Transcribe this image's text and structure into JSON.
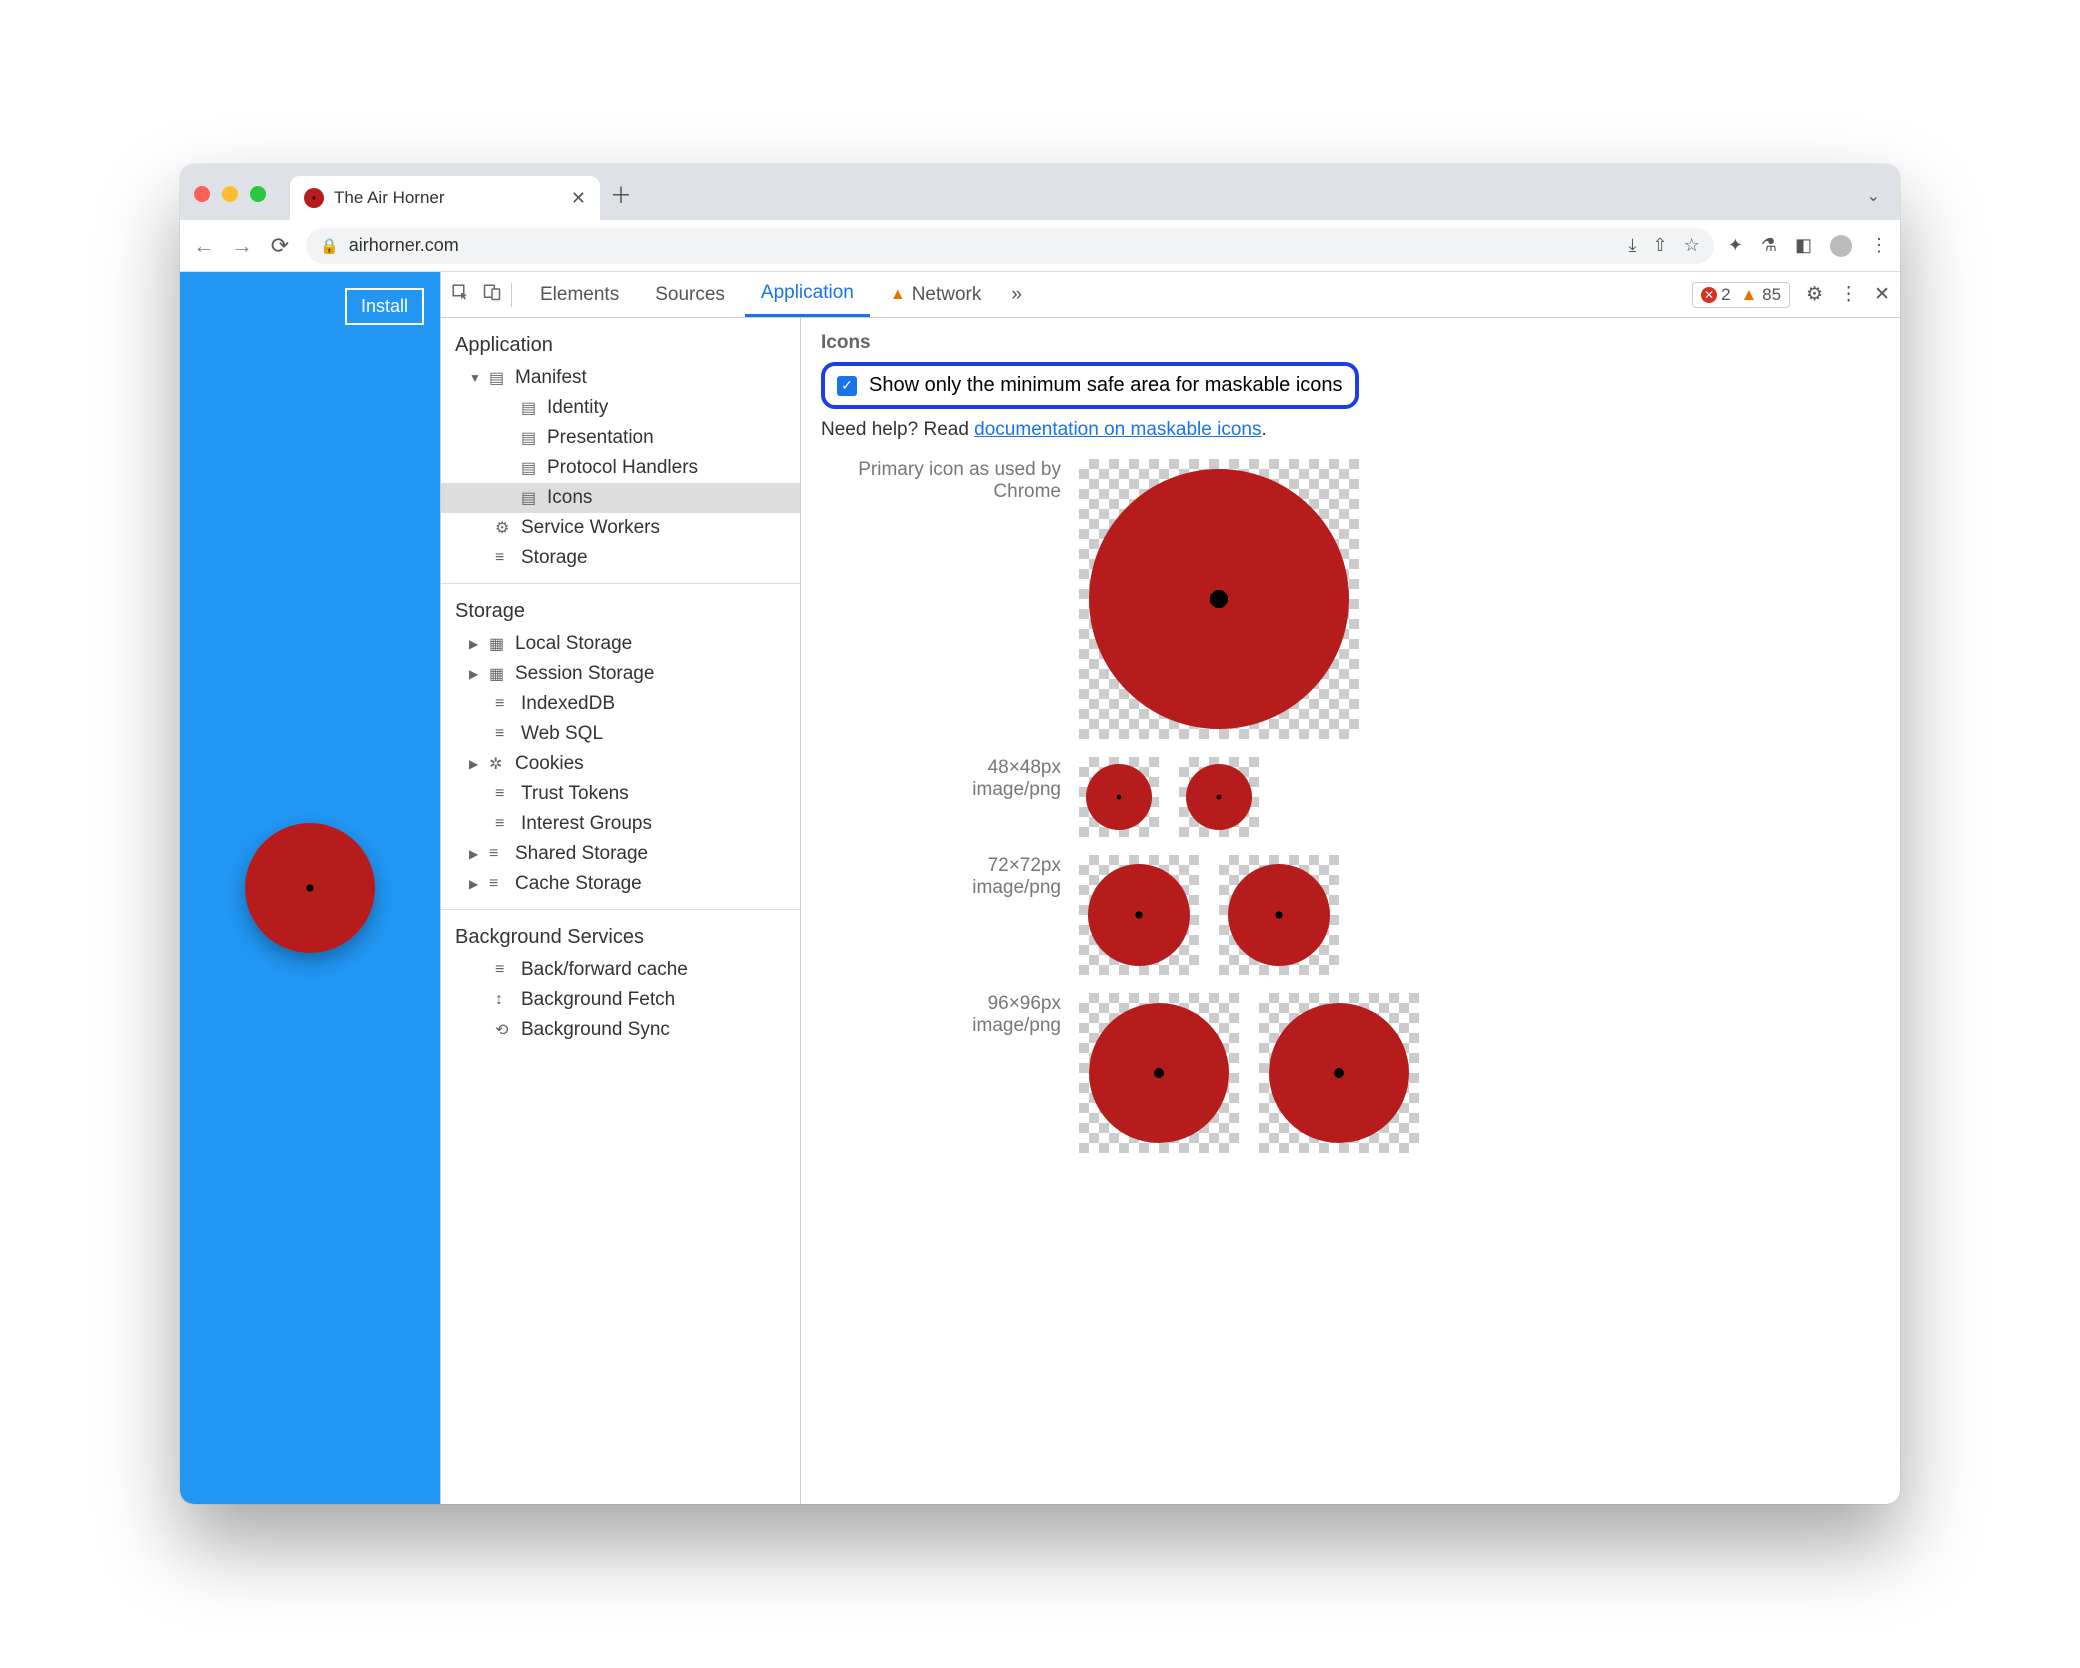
{
  "browser": {
    "tab_title": "The Air Horner",
    "url": "airhorner.com"
  },
  "page": {
    "install_label": "Install"
  },
  "devtools": {
    "tabs": {
      "elements": "Elements",
      "sources": "Sources",
      "application": "Application",
      "network": "Network"
    },
    "errors": "2",
    "warnings": "85",
    "sidebar": {
      "application": "Application",
      "manifest": "Manifest",
      "identity": "Identity",
      "presentation": "Presentation",
      "protocol_handlers": "Protocol Handlers",
      "icons": "Icons",
      "service_workers": "Service Workers",
      "storage_app": "Storage",
      "storage_head": "Storage",
      "local_storage": "Local Storage",
      "session_storage": "Session Storage",
      "indexeddb": "IndexedDB",
      "websql": "Web SQL",
      "cookies": "Cookies",
      "trust_tokens": "Trust Tokens",
      "interest_groups": "Interest Groups",
      "shared_storage": "Shared Storage",
      "cache_storage": "Cache Storage",
      "bg_head": "Background Services",
      "bf_cache": "Back/forward cache",
      "bg_fetch": "Background Fetch",
      "bg_sync": "Background Sync"
    },
    "main": {
      "section_title": "Icons",
      "checkbox_label": "Show only the minimum safe area for maskable icons",
      "help_prefix": "Need help? Read ",
      "help_link": "documentation on maskable icons",
      "help_suffix": ".",
      "primary_label_1": "Primary icon as used by",
      "primary_label_2": "Chrome",
      "rows": [
        {
          "size": "48×48px",
          "type": "image/png"
        },
        {
          "size": "72×72px",
          "type": "image/png"
        },
        {
          "size": "96×96px",
          "type": "image/png"
        }
      ]
    }
  }
}
